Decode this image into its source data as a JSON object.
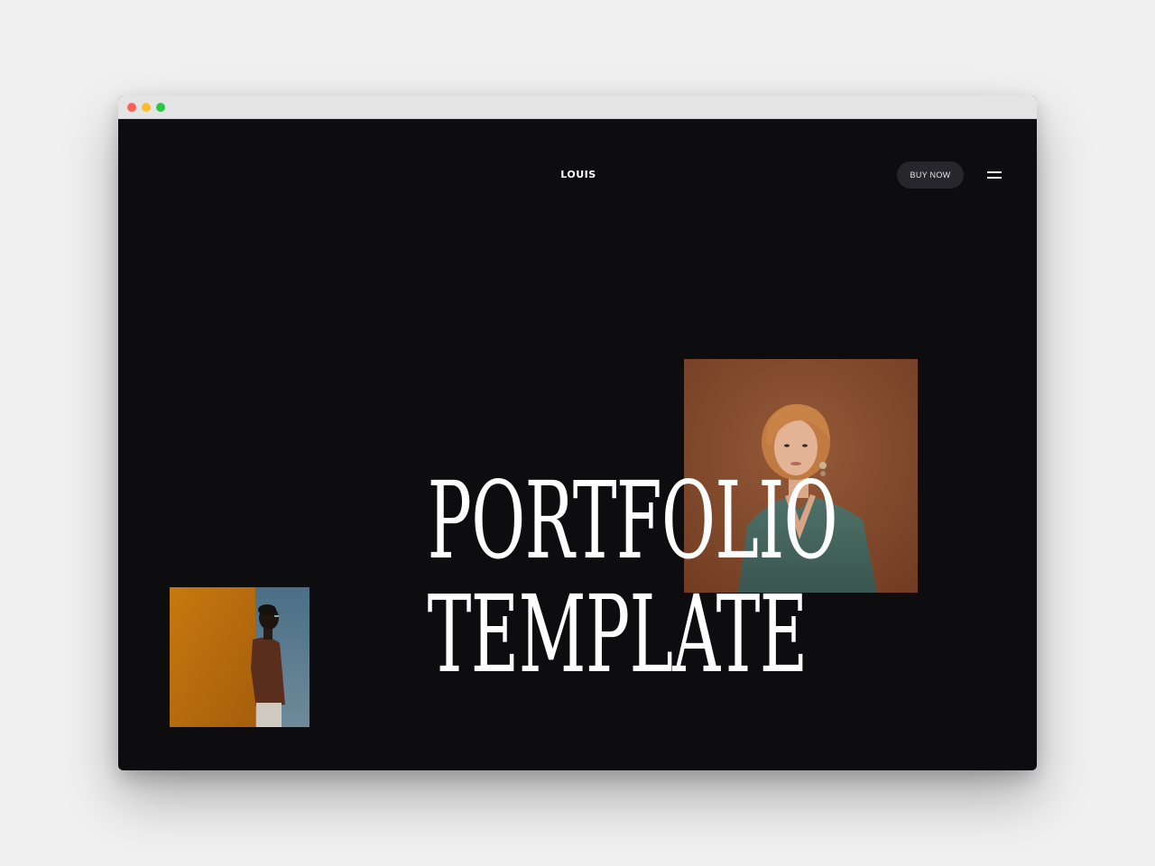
{
  "header": {
    "logo_text": "LOUIS",
    "buy_label": "BUY NOW",
    "menu_icon": "hamburger-menu-icon"
  },
  "hero": {
    "title_line1": "PORTFOLIO",
    "title_line2": "TEMPLATE"
  },
  "images": {
    "woman_photo": "portrait-woman-green-blouse",
    "man_photo": "profile-man-orange-wall"
  },
  "colors": {
    "background": "#0d0d10",
    "button_bg": "#26262c",
    "text": "#ffffff",
    "photo_brown": "#8f5232",
    "photo_orange": "#c47a14"
  }
}
